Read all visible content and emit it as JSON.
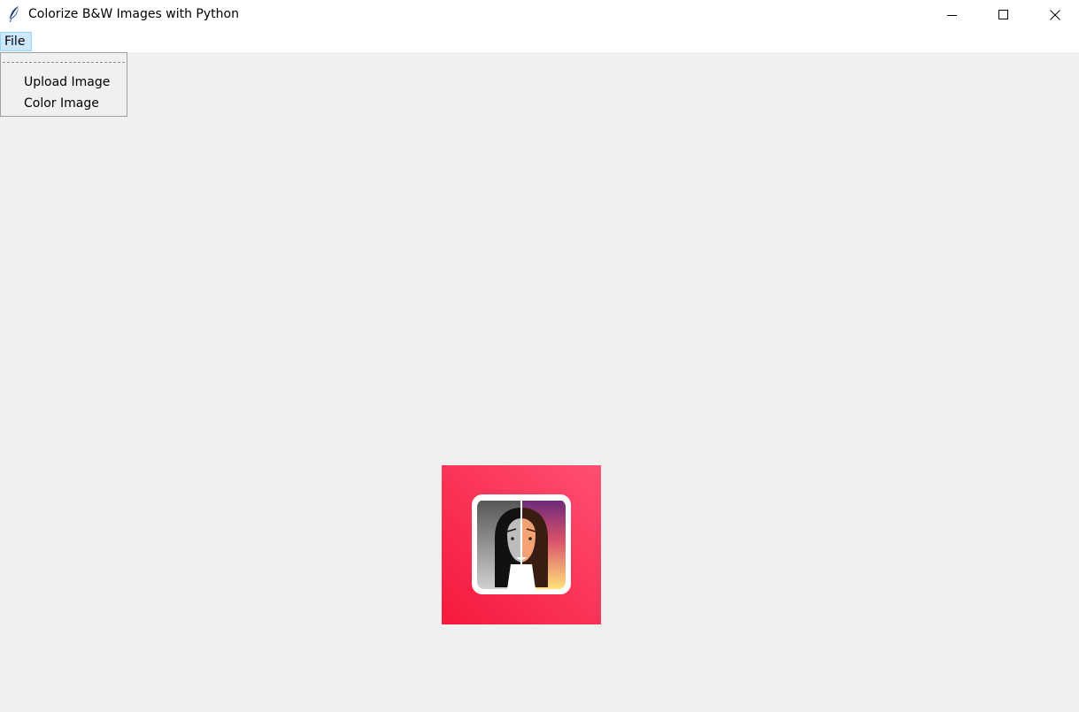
{
  "window": {
    "title": "Colorize B&W Images with Python",
    "icon": "feather-icon",
    "controls": [
      "minimize-icon",
      "maximize-icon",
      "close-icon"
    ]
  },
  "menubar": {
    "items": [
      {
        "label": "File",
        "active": true
      }
    ]
  },
  "file_menu": {
    "items": [
      {
        "label": "Upload Image"
      },
      {
        "label": "Color Image"
      }
    ]
  },
  "preview": {
    "icon": "colorize-face-icon",
    "colors": {
      "background_top": "#ff4f73",
      "background_bottom": "#f5193c"
    }
  }
}
